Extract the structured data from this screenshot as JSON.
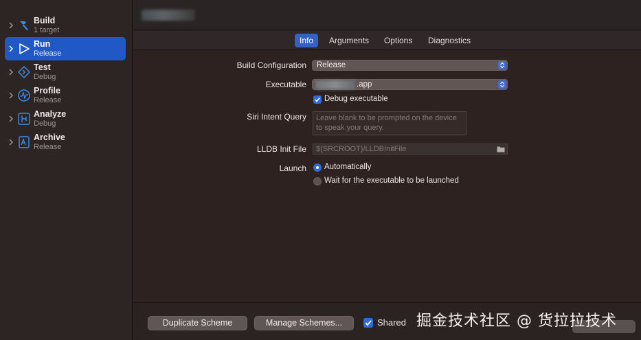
{
  "sidebar": {
    "actions": [
      {
        "name": "Build",
        "sub": "1 target",
        "icon": "hammer-icon"
      },
      {
        "name": "Run",
        "sub": "Release",
        "icon": "play-icon"
      },
      {
        "name": "Test",
        "sub": "Debug",
        "icon": "diamond-icon"
      },
      {
        "name": "Profile",
        "sub": "Release",
        "icon": "gauge-icon"
      },
      {
        "name": "Analyze",
        "sub": "Debug",
        "icon": "analyze-icon"
      },
      {
        "name": "Archive",
        "sub": "Release",
        "icon": "archive-icon"
      }
    ],
    "selected_index": 1
  },
  "tabs": [
    "Info",
    "Arguments",
    "Options",
    "Diagnostics"
  ],
  "active_tab": "Info",
  "info": {
    "build_config_label": "Build Configuration",
    "build_config_value": "Release",
    "executable_label": "Executable",
    "executable_value": ".app",
    "debug_executable_label": "Debug executable",
    "debug_executable_checked": true,
    "siri_label": "Siri Intent Query",
    "siri_placeholder": "Leave blank to be prompted on the device to speak your query.",
    "lldb_label": "LLDB Init File",
    "lldb_placeholder": "$(SRCROOT)/LLDBInitFile",
    "launch_label": "Launch",
    "launch_options": [
      "Automatically",
      "Wait for the executable to be launched"
    ],
    "launch_selected": "Automatically"
  },
  "bottom": {
    "duplicate_label": "Duplicate Scheme",
    "manage_label": "Manage Schemes...",
    "shared_label": "Shared",
    "shared_checked": true,
    "watermark": "掘金技术社区 @ 货拉拉技术"
  },
  "colors": {
    "accent": "#2f6bdf",
    "selection": "#2058c6",
    "background": "#2d2220"
  }
}
